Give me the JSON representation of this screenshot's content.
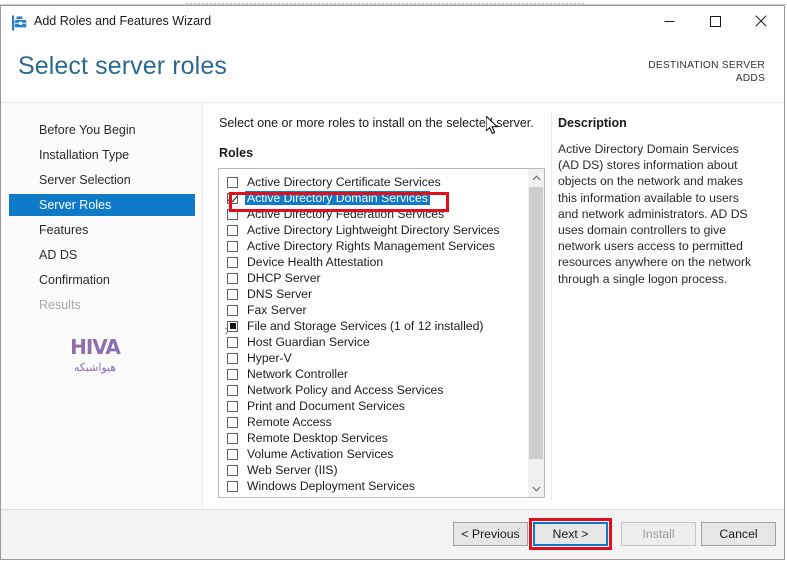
{
  "window": {
    "title": "Add Roles and Features Wizard",
    "icon": "toolbox-icon",
    "controls": {
      "minimize": "Minimize",
      "maximize": "Maximize",
      "close": "Close"
    }
  },
  "header": {
    "page_title": "Select server roles",
    "destination_label": "DESTINATION SERVER",
    "destination_value": "ADDS"
  },
  "sidebar": {
    "items": [
      {
        "label": "Before You Begin",
        "state": "normal"
      },
      {
        "label": "Installation Type",
        "state": "normal"
      },
      {
        "label": "Server Selection",
        "state": "normal"
      },
      {
        "label": "Server Roles",
        "state": "selected"
      },
      {
        "label": "Features",
        "state": "normal"
      },
      {
        "label": "AD DS",
        "state": "normal"
      },
      {
        "label": "Confirmation",
        "state": "normal"
      },
      {
        "label": "Results",
        "state": "disabled"
      }
    ],
    "logo": {
      "mark": "HIVA",
      "subtitle": "هیواشبکه",
      "color": "#8e6fae"
    }
  },
  "content": {
    "instruction": "Select one or more roles to install on the selected server.",
    "roles_label": "Roles",
    "roles": [
      {
        "label": "Active Directory Certificate Services",
        "checkbox": "unchecked",
        "selected": false,
        "expander": false
      },
      {
        "label": "Active Directory Domain Services",
        "checkbox": "checked",
        "selected": true,
        "expander": false
      },
      {
        "label": "Active Directory Federation Services",
        "checkbox": "unchecked",
        "selected": false,
        "expander": false
      },
      {
        "label": "Active Directory Lightweight Directory Services",
        "checkbox": "unchecked",
        "selected": false,
        "expander": false
      },
      {
        "label": "Active Directory Rights Management Services",
        "checkbox": "unchecked",
        "selected": false,
        "expander": false
      },
      {
        "label": "Device Health Attestation",
        "checkbox": "unchecked",
        "selected": false,
        "expander": false
      },
      {
        "label": "DHCP Server",
        "checkbox": "unchecked",
        "selected": false,
        "expander": false
      },
      {
        "label": "DNS Server",
        "checkbox": "unchecked",
        "selected": false,
        "expander": false
      },
      {
        "label": "Fax Server",
        "checkbox": "unchecked",
        "selected": false,
        "expander": false
      },
      {
        "label": "File and Storage Services (1 of 12 installed)",
        "checkbox": "partial",
        "selected": false,
        "expander": true
      },
      {
        "label": "Host Guardian Service",
        "checkbox": "unchecked",
        "selected": false,
        "expander": false
      },
      {
        "label": "Hyper-V",
        "checkbox": "unchecked",
        "selected": false,
        "expander": false
      },
      {
        "label": "Network Controller",
        "checkbox": "unchecked",
        "selected": false,
        "expander": false
      },
      {
        "label": "Network Policy and Access Services",
        "checkbox": "unchecked",
        "selected": false,
        "expander": false
      },
      {
        "label": "Print and Document Services",
        "checkbox": "unchecked",
        "selected": false,
        "expander": false
      },
      {
        "label": "Remote Access",
        "checkbox": "unchecked",
        "selected": false,
        "expander": false
      },
      {
        "label": "Remote Desktop Services",
        "checkbox": "unchecked",
        "selected": false,
        "expander": false
      },
      {
        "label": "Volume Activation Services",
        "checkbox": "unchecked",
        "selected": false,
        "expander": false
      },
      {
        "label": "Web Server (IIS)",
        "checkbox": "unchecked",
        "selected": false,
        "expander": false
      },
      {
        "label": "Windows Deployment Services",
        "checkbox": "unchecked",
        "selected": false,
        "expander": false
      }
    ],
    "scrollbar": {
      "up_arrow": "▲",
      "down_arrow": "▼"
    }
  },
  "description": {
    "title": "Description",
    "text": "Active Directory Domain Services (AD DS) stores information about objects on the network and makes this information available to users and network administrators. AD DS uses domain controllers to give network users access to permitted resources anywhere on the network through a single logon process."
  },
  "footer": {
    "previous": "< Previous",
    "next": "Next >",
    "install": "Install",
    "cancel": "Cancel",
    "install_disabled": true,
    "next_focused": true
  },
  "annotations": {
    "accent_color": "#e00f1a",
    "selection_color": "#0f7ac7",
    "title_color": "#2a6a8e"
  }
}
